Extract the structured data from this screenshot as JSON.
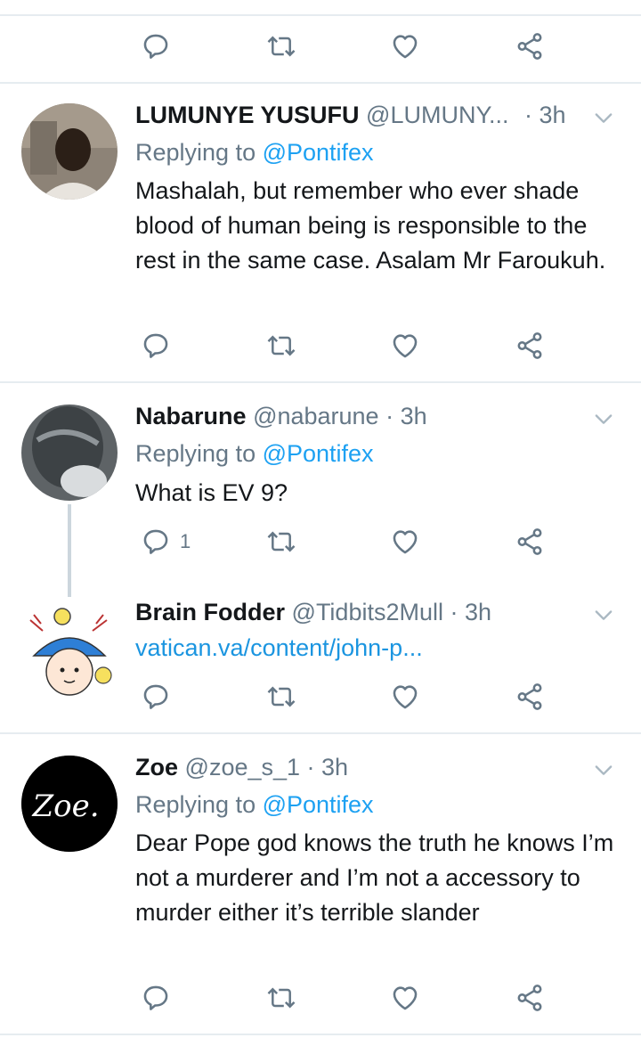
{
  "colors": {
    "accent": "#1da1f2",
    "muted": "#657786",
    "divider": "#e6ecf0"
  },
  "icons": {
    "reply": "reply-icon",
    "retweet": "retweet-icon",
    "like": "heart-icon",
    "share": "share-icon",
    "more": "chevron-down-icon"
  },
  "top_actions": {
    "reply_count": "",
    "retweet_count": "",
    "like_count": ""
  },
  "tweets": [
    {
      "name": "LUMUNYE YUSUFU",
      "handle": "@LUMUNY...",
      "time": "· 3h",
      "replying_prefix": "Replying to ",
      "replying_to": "@Pontifex",
      "text": "Mashalah, but remember who ever shade blood of human being is responsible to the rest in the same case. Asalam Mr Faroukuh.",
      "reply_count": ""
    },
    {
      "name": "Nabarune",
      "handle": "@nabarune",
      "time": "· 3h",
      "replying_prefix": "Replying to ",
      "replying_to": "@Pontifex",
      "text": "What is EV 9?",
      "reply_count": "1"
    },
    {
      "name": "Brain Fodder",
      "handle": "@Tidbits2Mull",
      "time": "· 3h",
      "link": "vatican.va/content/john-p...",
      "reply_count": ""
    },
    {
      "name": "Zoe",
      "handle": "@zoe_s_1",
      "time": "· 3h",
      "replying_prefix": "Replying to ",
      "replying_to": "@Pontifex",
      "text": "Dear Pope god knows the truth he knows I’m not a murderer and I’m not a accessory to murder either it’s terrible slander",
      "reply_count": ""
    }
  ],
  "avatars": {
    "zoe_text": "Zoe."
  }
}
